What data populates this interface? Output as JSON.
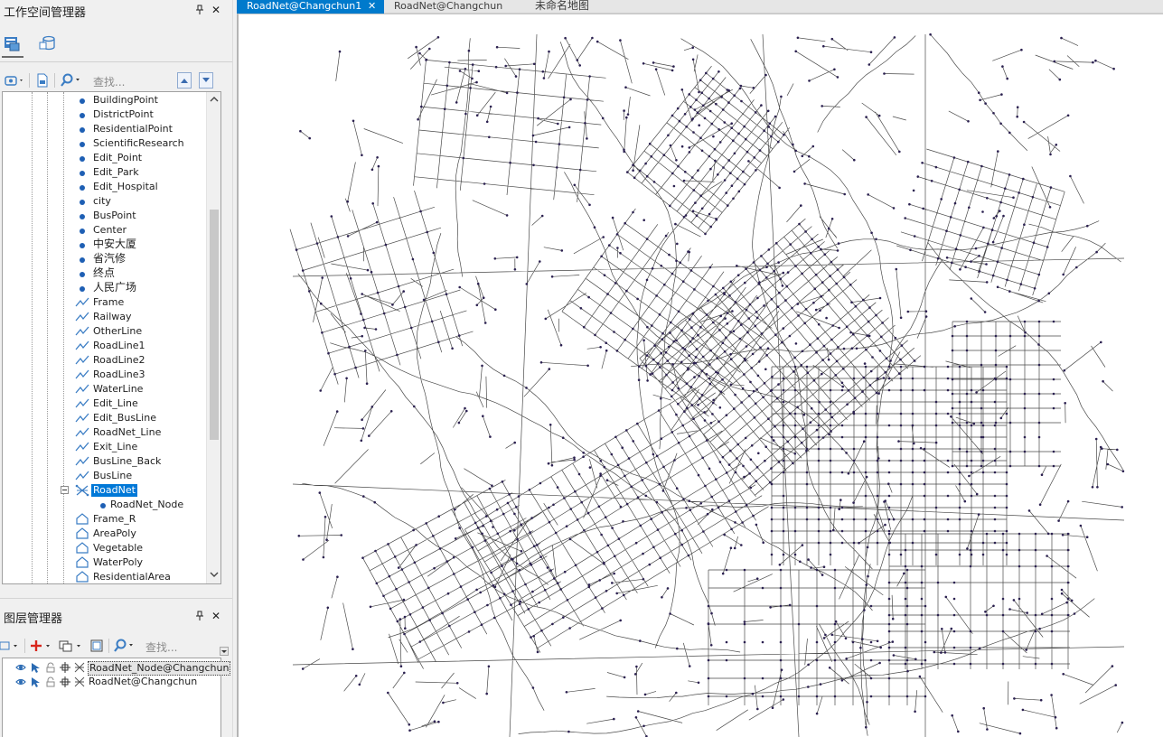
{
  "workspace": {
    "title": "工作空间管理器",
    "pin_icon": "pin-icon",
    "close_symbol": "✕",
    "search_placeholder": "查找...",
    "tree_items": [
      {
        "label": "BuildingPoint",
        "kind": "point"
      },
      {
        "label": "DistrictPoint",
        "kind": "point"
      },
      {
        "label": "ResidentialPoint",
        "kind": "point"
      },
      {
        "label": "ScientificResearch",
        "kind": "point"
      },
      {
        "label": "Edit_Point",
        "kind": "point"
      },
      {
        "label": "Edit_Park",
        "kind": "point"
      },
      {
        "label": "Edit_Hospital",
        "kind": "point"
      },
      {
        "label": "city",
        "kind": "point"
      },
      {
        "label": "BusPoint",
        "kind": "point"
      },
      {
        "label": "Center",
        "kind": "point"
      },
      {
        "label": "中安大厦",
        "kind": "point"
      },
      {
        "label": "省汽修",
        "kind": "point"
      },
      {
        "label": "终点",
        "kind": "point"
      },
      {
        "label": "人民广场",
        "kind": "point"
      },
      {
        "label": "Frame",
        "kind": "line"
      },
      {
        "label": "Railway",
        "kind": "line"
      },
      {
        "label": "OtherLine",
        "kind": "line"
      },
      {
        "label": "RoadLine1",
        "kind": "line"
      },
      {
        "label": "RoadLine2",
        "kind": "line"
      },
      {
        "label": "RoadLine3",
        "kind": "line"
      },
      {
        "label": "WaterLine",
        "kind": "line"
      },
      {
        "label": "Edit_Line",
        "kind": "line"
      },
      {
        "label": "Edit_BusLine",
        "kind": "line"
      },
      {
        "label": "RoadNet_Line",
        "kind": "line"
      },
      {
        "label": "Exit_Line",
        "kind": "line"
      },
      {
        "label": "BusLine_Back",
        "kind": "line"
      },
      {
        "label": "BusLine",
        "kind": "line"
      },
      {
        "label": "RoadNet",
        "kind": "network",
        "selected": true,
        "expanded": true
      },
      {
        "label": "RoadNet_Node",
        "kind": "child-point"
      },
      {
        "label": "Frame_R",
        "kind": "region"
      },
      {
        "label": "AreaPoly",
        "kind": "region"
      },
      {
        "label": "Vegetable",
        "kind": "region"
      },
      {
        "label": "WaterPoly",
        "kind": "region"
      },
      {
        "label": "ResidentialArea",
        "kind": "region"
      }
    ]
  },
  "layer_manager": {
    "title": "图层管理器",
    "close_symbol": "✕",
    "search_placeholder": "查找...",
    "layers": [
      {
        "name": "RoadNet_Node@Changchun",
        "selected": true
      },
      {
        "name": "RoadNet@Changchun",
        "selected": false
      }
    ]
  },
  "document_tabs": [
    {
      "label": "RoadNet@Changchun1",
      "active": true,
      "close_symbol": "✕"
    },
    {
      "label": "RoadNet@Changchun",
      "active": false
    },
    {
      "label": "未命名地图",
      "active": false
    }
  ],
  "map": {
    "line_color": "#4a4a4a",
    "node_color": "#2b2050"
  },
  "colors": {
    "accent": "#007acc",
    "selection": "#0078d7",
    "point_symbol": "#1e5fb4"
  }
}
